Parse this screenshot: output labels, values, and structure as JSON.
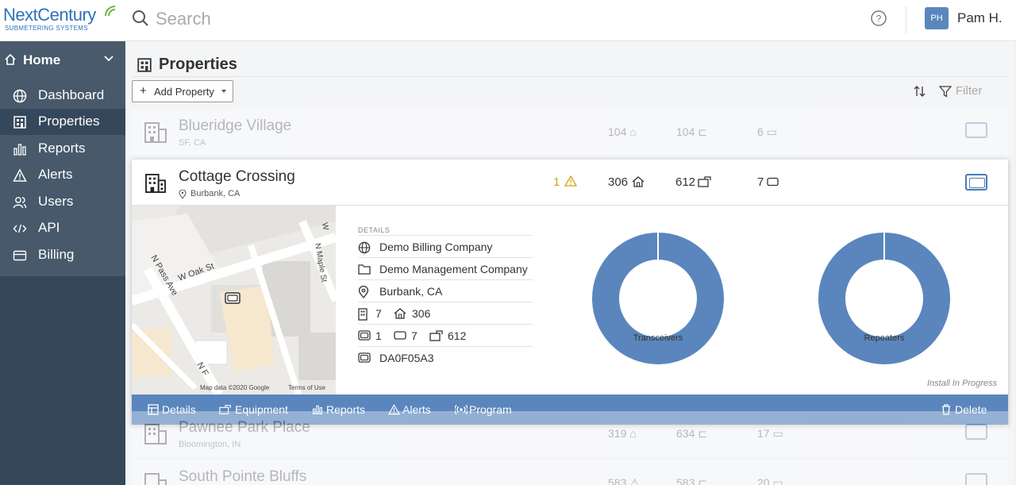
{
  "brand": {
    "name": "NextCentury",
    "tagline": "SUBMETERING SYSTEMS"
  },
  "search": {
    "placeholder": "Search"
  },
  "user": {
    "initials": "PH",
    "name": "Pam H."
  },
  "sidebar": {
    "header": "Home",
    "items": [
      {
        "label": "Dashboard",
        "icon": "globe-icon"
      },
      {
        "label": "Properties",
        "icon": "building-icon",
        "active": true
      },
      {
        "label": "Reports",
        "icon": "bar-chart-icon"
      },
      {
        "label": "Alerts",
        "icon": "warning-icon"
      },
      {
        "label": "Users",
        "icon": "users-icon"
      },
      {
        "label": "API",
        "icon": "code-icon"
      },
      {
        "label": "Billing",
        "icon": "credit-card-icon"
      }
    ]
  },
  "page": {
    "title": "Properties",
    "add_label": "Add Property",
    "filter_label": "Filter"
  },
  "properties": [
    {
      "name": "Blueridge Village",
      "location": "SF, CA",
      "units": "104",
      "meters": "104",
      "gateways": "6"
    },
    {
      "name": "Cottage Crossing",
      "location": "Burbank, CA",
      "alerts": "1",
      "units": "306",
      "meters": "612",
      "gateways": "7"
    },
    {
      "name": "Pawnee Park Place",
      "location": "Bloomington, IN",
      "units": "319",
      "meters": "634",
      "gateways": "17"
    },
    {
      "name": "South Pointe Bluffs",
      "location": "",
      "units": "583",
      "meters": "583",
      "gateways": "20"
    }
  ],
  "details": {
    "label": "DETAILS",
    "billing_company": "Demo Billing Company",
    "management_company": "Demo Management Company",
    "location": "Burbank, CA",
    "buildings": "7",
    "units": "306",
    "gateways": "1",
    "repeaters": "7",
    "meters": "612",
    "gateway_id": "DA0F05A3"
  },
  "map": {
    "streets": [
      "W Oak St",
      "N Pass Ave",
      "N Maple St",
      "W",
      "N F"
    ],
    "credit": "Map data ©2020 Google",
    "terms": "Terms of Use"
  },
  "donuts": [
    {
      "label": "Transceivers",
      "value": "610"
    },
    {
      "label": "Repeaters",
      "value": "7"
    }
  ],
  "install_status": "Install In Progress",
  "actions": [
    "Details",
    "Equipment",
    "Reports",
    "Alerts",
    "Program"
  ],
  "delete_label": "Delete",
  "colors": {
    "accent": "#5a86bd",
    "sidebar": "#35475a",
    "sidebar_menu": "#47596b",
    "alert": "#d4a017"
  }
}
